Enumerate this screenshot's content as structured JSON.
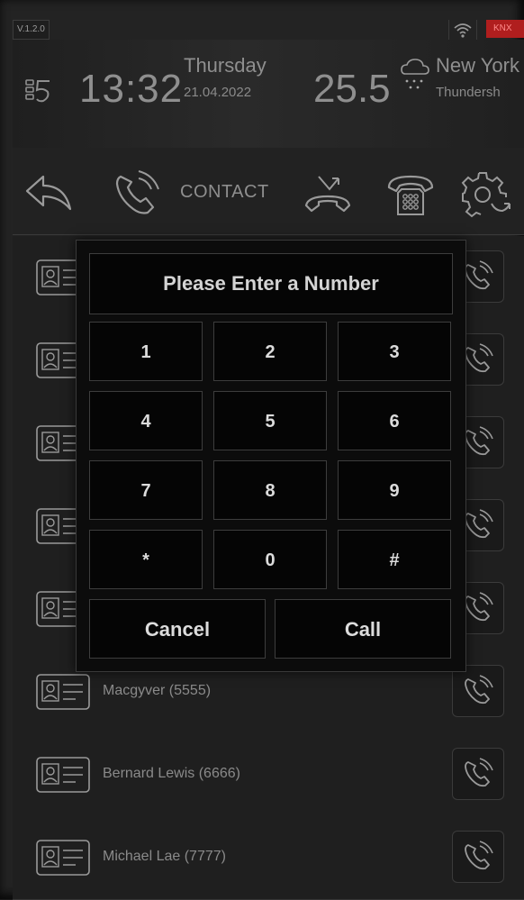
{
  "status": {
    "version": "V.1.2.0",
    "knx": "KNX"
  },
  "header": {
    "time": "13:32",
    "day": "Thursday",
    "date": "21.04.2022",
    "temperature": "25.5",
    "city": "New York",
    "condition": "Thundersh"
  },
  "toolbar": {
    "contact_label": "CONTACT"
  },
  "contacts": [
    {
      "label": ""
    },
    {
      "label": ""
    },
    {
      "label": ""
    },
    {
      "label": ""
    },
    {
      "label": ""
    },
    {
      "label": "Macgyver (5555)"
    },
    {
      "label": "Bernard Lewis (6666)"
    },
    {
      "label": "Michael Lae (7777)"
    }
  ],
  "dialog": {
    "title": "Please Enter a Number",
    "keys": [
      "1",
      "2",
      "3",
      "4",
      "5",
      "6",
      "7",
      "8",
      "9",
      "*",
      "0",
      "#"
    ],
    "cancel": "Cancel",
    "call": "Call"
  },
  "colors": {
    "background": "#232323",
    "text": "#8d8d8d",
    "dialog_bg": "#050505",
    "knx_badge": "#b01e1e"
  },
  "icons": [
    "menu-icon",
    "wifi-icon",
    "cloud-icon",
    "snow-icon",
    "back-icon",
    "phone-icon",
    "hangup-icon",
    "desk-phone-icon",
    "settings-icon",
    "contact-card-icon",
    "call-icon"
  ]
}
